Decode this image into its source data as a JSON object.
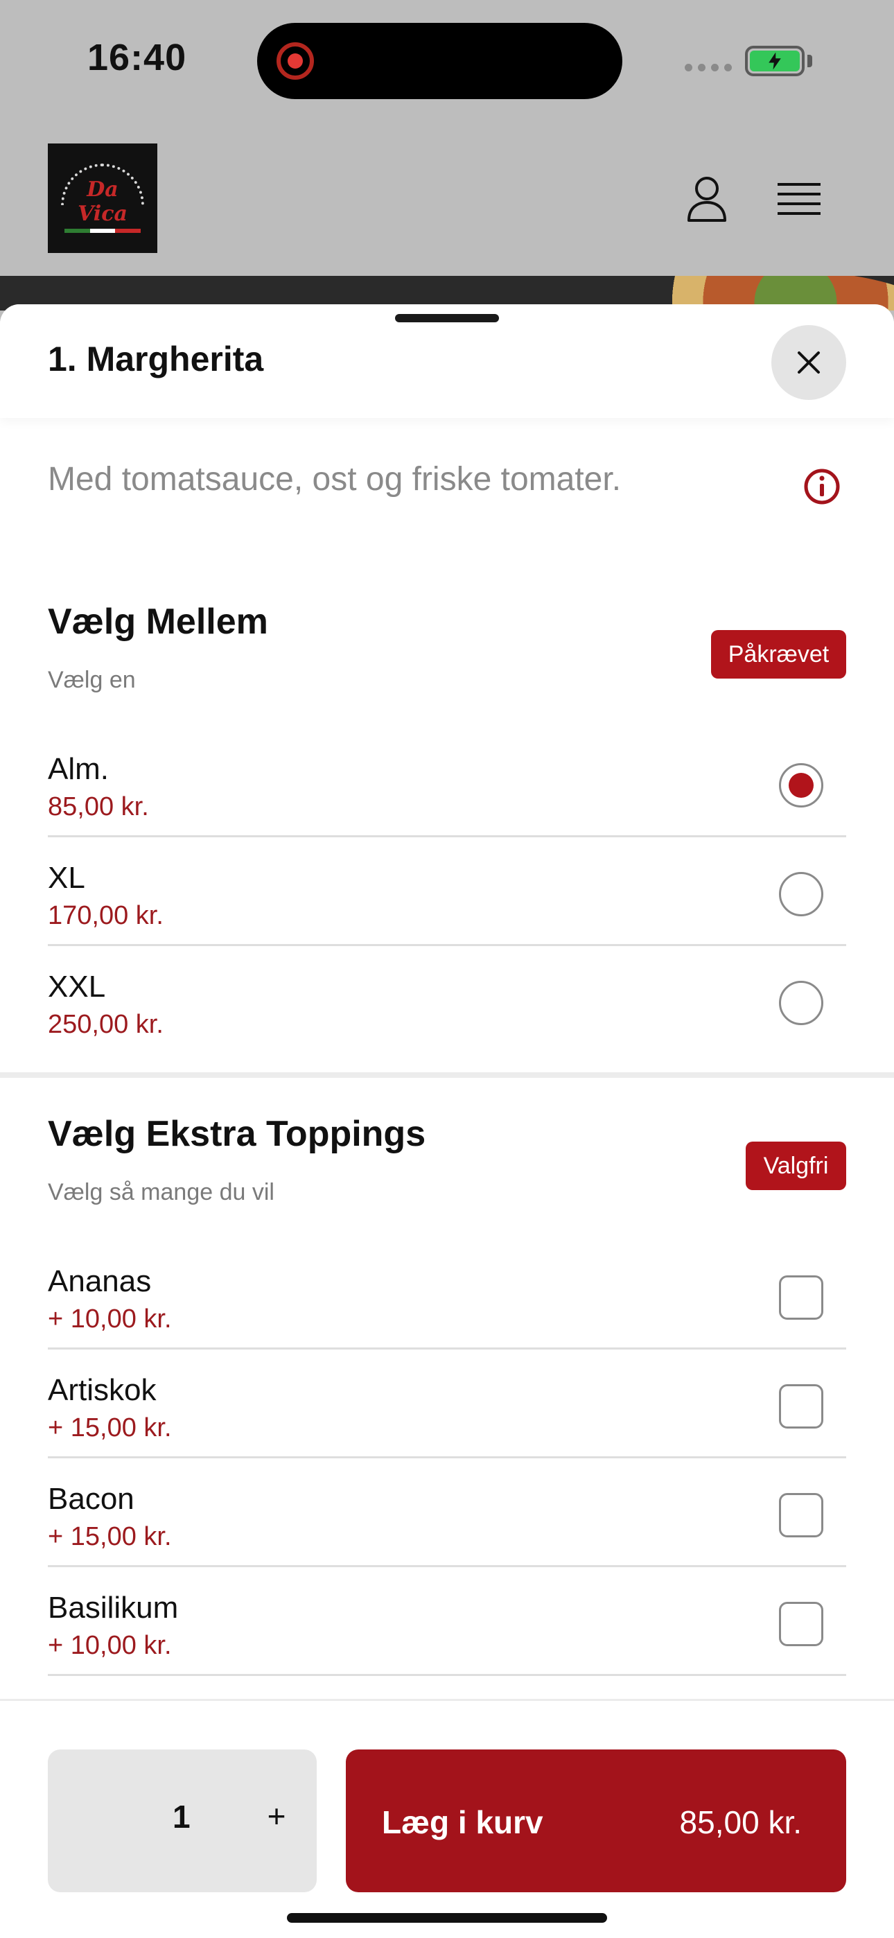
{
  "status_bar": {
    "time": "16:40"
  },
  "header": {
    "logo_text": "Da Vica",
    "logo_flag_colors": [
      "#2e7d32",
      "#ffffff",
      "#c62828"
    ]
  },
  "sheet": {
    "title": "1. Margherita",
    "description": "Med tomatsauce, ost og friske tomater."
  },
  "groups": [
    {
      "title": "Vælg Mellem",
      "subtitle": "Vælg en",
      "badge": "Påkrævet",
      "type": "radio",
      "options": [
        {
          "name": "Alm.",
          "price": "85,00 kr.",
          "selected": true
        },
        {
          "name": "XL",
          "price": "170,00 kr.",
          "selected": false
        },
        {
          "name": "XXL",
          "price": "250,00 kr.",
          "selected": false
        }
      ]
    },
    {
      "title": "Vælg Ekstra Toppings",
      "subtitle": "Vælg så mange du vil",
      "badge": "Valgfri",
      "type": "checkbox",
      "options": [
        {
          "name": "Ananas",
          "price": "+ 10,00 kr.",
          "selected": false
        },
        {
          "name": "Artiskok",
          "price": "+ 15,00 kr.",
          "selected": false
        },
        {
          "name": "Bacon",
          "price": "+ 15,00 kr.",
          "selected": false
        },
        {
          "name": "Basilikum",
          "price": "+ 10,00 kr.",
          "selected": false
        }
      ]
    }
  ],
  "footer": {
    "quantity": "1",
    "plus_label": "+",
    "add_label": "Læg i kurv",
    "add_price": "85,00 kr."
  },
  "colors": {
    "accent": "#b1141b",
    "price_text": "#9c1a1e",
    "header_bg": "#bdbdbd"
  }
}
